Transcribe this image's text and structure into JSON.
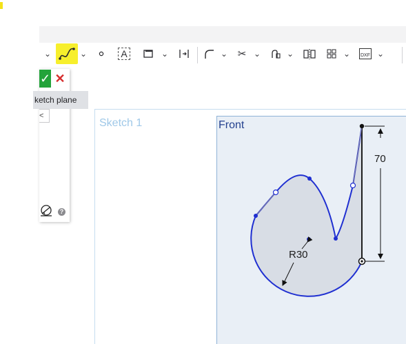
{
  "toolbar": {
    "tools": [
      {
        "name": "spline",
        "icon": "spline-icon",
        "highlighted": true
      },
      {
        "name": "point",
        "icon": "point-icon"
      },
      {
        "name": "text",
        "icon": "text-icon",
        "glyph": "A"
      },
      {
        "name": "rectangle",
        "icon": "rectangle-icon"
      },
      {
        "name": "constraint",
        "icon": "constraint-icon"
      },
      {
        "name": "fillet",
        "icon": "fillet-icon"
      },
      {
        "name": "trim",
        "icon": "trim-icon"
      },
      {
        "name": "use",
        "icon": "use-icon"
      },
      {
        "name": "mirror",
        "icon": "mirror-icon"
      },
      {
        "name": "pattern",
        "icon": "pattern-icon"
      },
      {
        "name": "dxf",
        "icon": "dxf-import-icon",
        "glyph": "DXF"
      }
    ],
    "highlight_color": "#f7ef2c"
  },
  "dialog": {
    "ok_glyph": "✓",
    "cancel_glyph": "✕",
    "tooltip": "ketch plane",
    "field_value": "<"
  },
  "canvas": {
    "sketch_name": "Sketch 1",
    "plane_name": "Front",
    "dimensions": {
      "vertical": "70",
      "radius": "R30"
    },
    "colors": {
      "sketch_curve": "#1f2fd1",
      "plane_fill": "#e9eff6",
      "region_fill": "#d8dde5"
    }
  }
}
